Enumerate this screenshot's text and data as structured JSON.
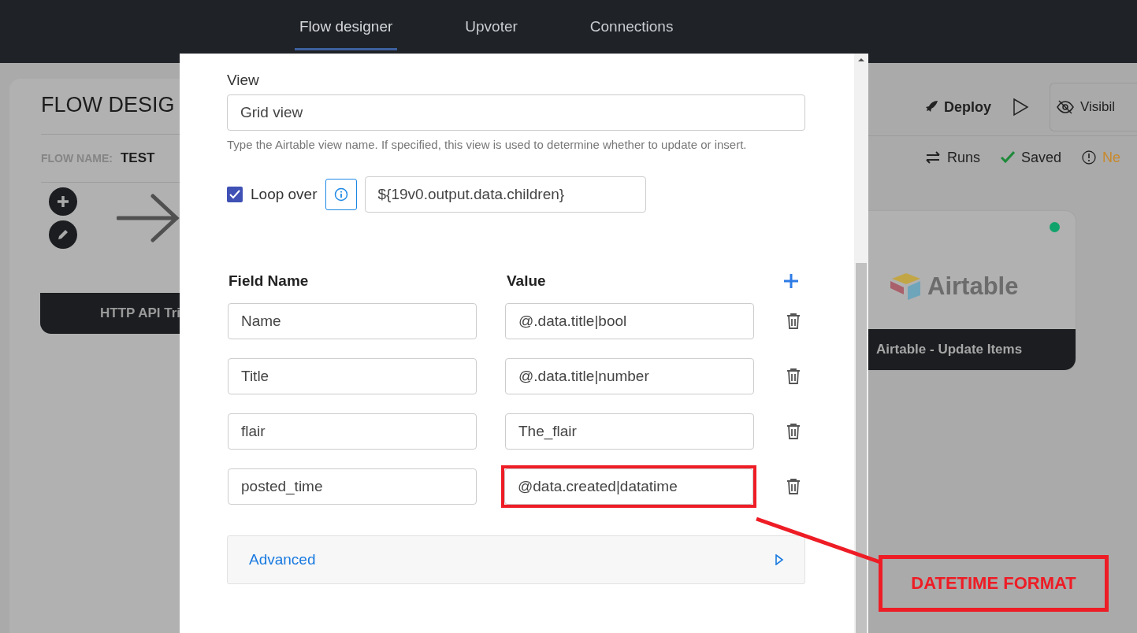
{
  "nav": {
    "tabs": [
      {
        "label": "Flow designer",
        "selected": true
      },
      {
        "label": "Upvoter",
        "selected": false
      },
      {
        "label": "Connections",
        "selected": false
      }
    ]
  },
  "background": {
    "title": "FLOW DESIG",
    "flow_name_label": "FLOW NAME:",
    "flow_name": "TEST",
    "trigger_node": "HTTP API Tri",
    "deploy": "Deploy",
    "visibility": "Visibil",
    "runs": "Runs",
    "status": "Saved",
    "notice": "Ne",
    "node": {
      "label": "Airtable - Update Items",
      "logo_text": "Airtable",
      "color": "#10a36b"
    }
  },
  "modal": {
    "view": {
      "label": "View",
      "value": "Grid view",
      "help": "Type the Airtable view name. If specified, this view is used to determine whether to update or insert."
    },
    "loop": {
      "checked": true,
      "label": "Loop over",
      "value": "${19v0.output.data.children}"
    },
    "fields": {
      "columns": [
        "Field Name",
        "Value"
      ],
      "rows": [
        {
          "name": "Name",
          "value": "@.data.title|bool",
          "highlighted": false
        },
        {
          "name": "Title",
          "value": "@.data.title|number",
          "highlighted": false
        },
        {
          "name": "flair",
          "value": "The_flair",
          "highlighted": false
        },
        {
          "name": "posted_time",
          "value": "@data.created|datatime",
          "highlighted": true
        }
      ]
    },
    "advanced": {
      "label": "Advanced",
      "expanded": false
    }
  },
  "annotation": {
    "label": "DATETIME FORMAT"
  }
}
